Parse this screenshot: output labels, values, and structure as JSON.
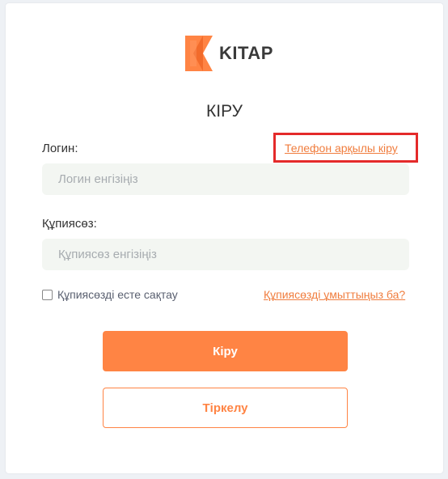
{
  "brand": {
    "name": "KITAP",
    "logo_icon": "kitap-logo-icon",
    "accent_color": "#ff8444",
    "accent_dark": "#f07d3e"
  },
  "page": {
    "title": "КІРУ"
  },
  "login": {
    "label": "Логин:",
    "placeholder": "Логин енгізіңіз",
    "value": ""
  },
  "phone_login_link": "Телефон арқылы кіру",
  "password": {
    "label": "Құпиясөз:",
    "placeholder": "Құпиясөз енгізіңіз",
    "value": ""
  },
  "remember_me": {
    "label": "Құпиясөзді есте сақтау",
    "checked": false
  },
  "forgot_password_link": "Құпиясөзді ұмыттыңыз ба?",
  "buttons": {
    "login": "Кіру",
    "register": "Тіркелу"
  },
  "highlight_color": "#e42a2a"
}
